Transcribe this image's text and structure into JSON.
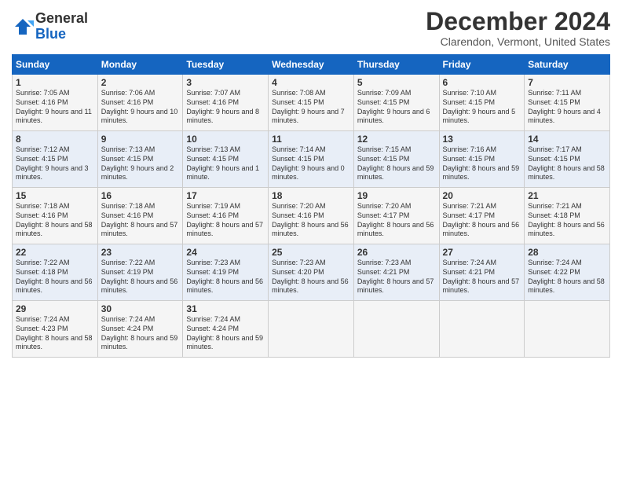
{
  "header": {
    "logo_line1": "General",
    "logo_line2": "Blue",
    "month_title": "December 2024",
    "location": "Clarendon, Vermont, United States"
  },
  "weekdays": [
    "Sunday",
    "Monday",
    "Tuesday",
    "Wednesday",
    "Thursday",
    "Friday",
    "Saturday"
  ],
  "weeks": [
    [
      {
        "day": 1,
        "rise": "7:05 AM",
        "set": "4:16 PM",
        "daylight": "9 hours and 11 minutes."
      },
      {
        "day": 2,
        "rise": "7:06 AM",
        "set": "4:16 PM",
        "daylight": "9 hours and 10 minutes."
      },
      {
        "day": 3,
        "rise": "7:07 AM",
        "set": "4:16 PM",
        "daylight": "9 hours and 8 minutes."
      },
      {
        "day": 4,
        "rise": "7:08 AM",
        "set": "4:15 PM",
        "daylight": "9 hours and 7 minutes."
      },
      {
        "day": 5,
        "rise": "7:09 AM",
        "set": "4:15 PM",
        "daylight": "9 hours and 6 minutes."
      },
      {
        "day": 6,
        "rise": "7:10 AM",
        "set": "4:15 PM",
        "daylight": "9 hours and 5 minutes."
      },
      {
        "day": 7,
        "rise": "7:11 AM",
        "set": "4:15 PM",
        "daylight": "9 hours and 4 minutes."
      }
    ],
    [
      {
        "day": 8,
        "rise": "7:12 AM",
        "set": "4:15 PM",
        "daylight": "9 hours and 3 minutes."
      },
      {
        "day": 9,
        "rise": "7:13 AM",
        "set": "4:15 PM",
        "daylight": "9 hours and 2 minutes."
      },
      {
        "day": 10,
        "rise": "7:13 AM",
        "set": "4:15 PM",
        "daylight": "9 hours and 1 minute."
      },
      {
        "day": 11,
        "rise": "7:14 AM",
        "set": "4:15 PM",
        "daylight": "9 hours and 0 minutes."
      },
      {
        "day": 12,
        "rise": "7:15 AM",
        "set": "4:15 PM",
        "daylight": "8 hours and 59 minutes."
      },
      {
        "day": 13,
        "rise": "7:16 AM",
        "set": "4:15 PM",
        "daylight": "8 hours and 59 minutes."
      },
      {
        "day": 14,
        "rise": "7:17 AM",
        "set": "4:15 PM",
        "daylight": "8 hours and 58 minutes."
      }
    ],
    [
      {
        "day": 15,
        "rise": "7:18 AM",
        "set": "4:16 PM",
        "daylight": "8 hours and 58 minutes."
      },
      {
        "day": 16,
        "rise": "7:18 AM",
        "set": "4:16 PM",
        "daylight": "8 hours and 57 minutes."
      },
      {
        "day": 17,
        "rise": "7:19 AM",
        "set": "4:16 PM",
        "daylight": "8 hours and 57 minutes."
      },
      {
        "day": 18,
        "rise": "7:20 AM",
        "set": "4:16 PM",
        "daylight": "8 hours and 56 minutes."
      },
      {
        "day": 19,
        "rise": "7:20 AM",
        "set": "4:17 PM",
        "daylight": "8 hours and 56 minutes."
      },
      {
        "day": 20,
        "rise": "7:21 AM",
        "set": "4:17 PM",
        "daylight": "8 hours and 56 minutes."
      },
      {
        "day": 21,
        "rise": "7:21 AM",
        "set": "4:18 PM",
        "daylight": "8 hours and 56 minutes."
      }
    ],
    [
      {
        "day": 22,
        "rise": "7:22 AM",
        "set": "4:18 PM",
        "daylight": "8 hours and 56 minutes."
      },
      {
        "day": 23,
        "rise": "7:22 AM",
        "set": "4:19 PM",
        "daylight": "8 hours and 56 minutes."
      },
      {
        "day": 24,
        "rise": "7:23 AM",
        "set": "4:19 PM",
        "daylight": "8 hours and 56 minutes."
      },
      {
        "day": 25,
        "rise": "7:23 AM",
        "set": "4:20 PM",
        "daylight": "8 hours and 56 minutes."
      },
      {
        "day": 26,
        "rise": "7:23 AM",
        "set": "4:21 PM",
        "daylight": "8 hours and 57 minutes."
      },
      {
        "day": 27,
        "rise": "7:24 AM",
        "set": "4:21 PM",
        "daylight": "8 hours and 57 minutes."
      },
      {
        "day": 28,
        "rise": "7:24 AM",
        "set": "4:22 PM",
        "daylight": "8 hours and 58 minutes."
      }
    ],
    [
      {
        "day": 29,
        "rise": "7:24 AM",
        "set": "4:23 PM",
        "daylight": "8 hours and 58 minutes."
      },
      {
        "day": 30,
        "rise": "7:24 AM",
        "set": "4:24 PM",
        "daylight": "8 hours and 59 minutes."
      },
      {
        "day": 31,
        "rise": "7:24 AM",
        "set": "4:24 PM",
        "daylight": "8 hours and 59 minutes."
      },
      null,
      null,
      null,
      null
    ]
  ]
}
